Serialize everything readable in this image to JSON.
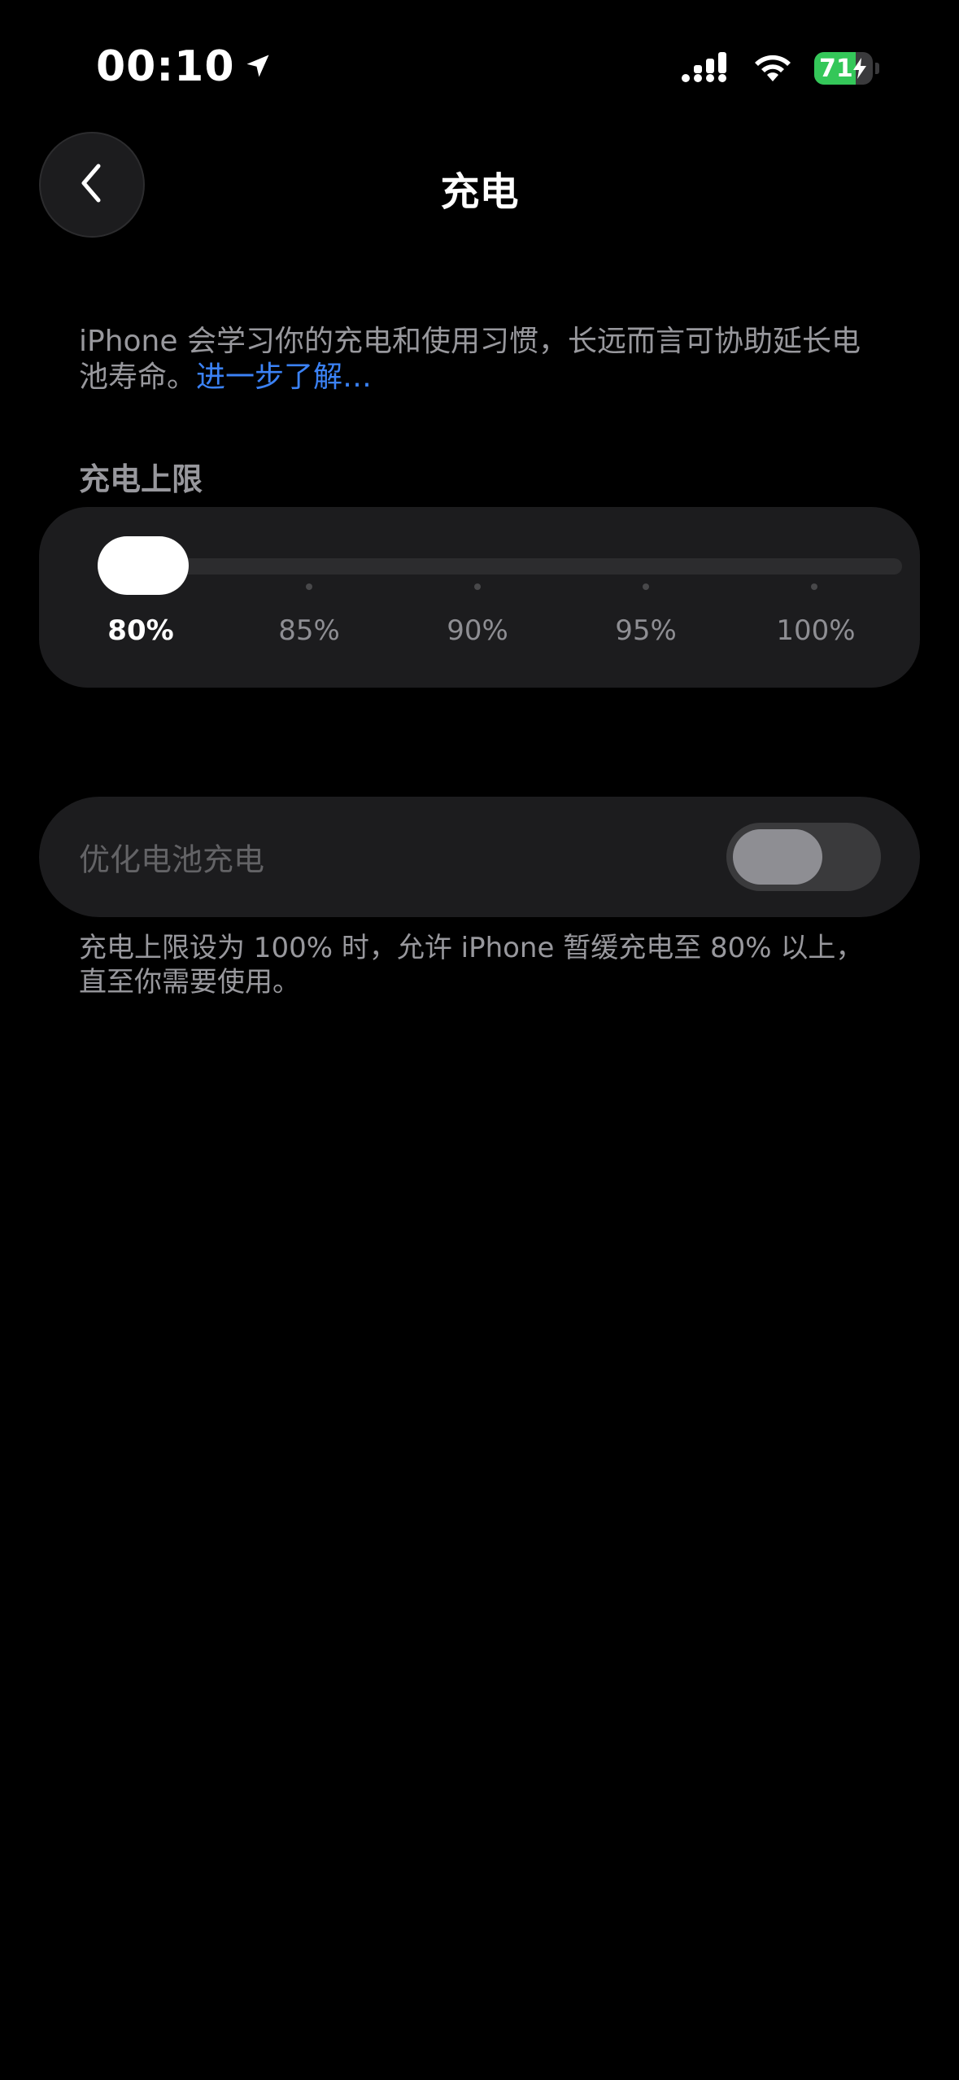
{
  "status_bar": {
    "time": "00:10",
    "location_icon": "location-arrow-icon",
    "signal_icon": "cellular-signal-icon",
    "wifi_icon": "wifi-icon",
    "battery_level": "71",
    "battery_fraction": 0.71,
    "battery_charging": true,
    "battery_color": "#34c759"
  },
  "nav": {
    "back_icon": "chevron-left-icon",
    "title": "充电"
  },
  "description": {
    "text": "iPhone 会学习你的充电和使用习惯，长远而言可协助延长电池寿命。",
    "link": "进一步了解…"
  },
  "charge_limit": {
    "header": "充电上限",
    "options": [
      "80%",
      "85%",
      "90%",
      "95%",
      "100%"
    ],
    "selected": "80%"
  },
  "optimize": {
    "label": "优化电池充电",
    "enabled": false,
    "disabled_state": true
  },
  "footnote": {
    "text": "充电上限设为 100% 时，允许 iPhone 暂缓充电至 80% 以上，直至你需要使用。"
  }
}
